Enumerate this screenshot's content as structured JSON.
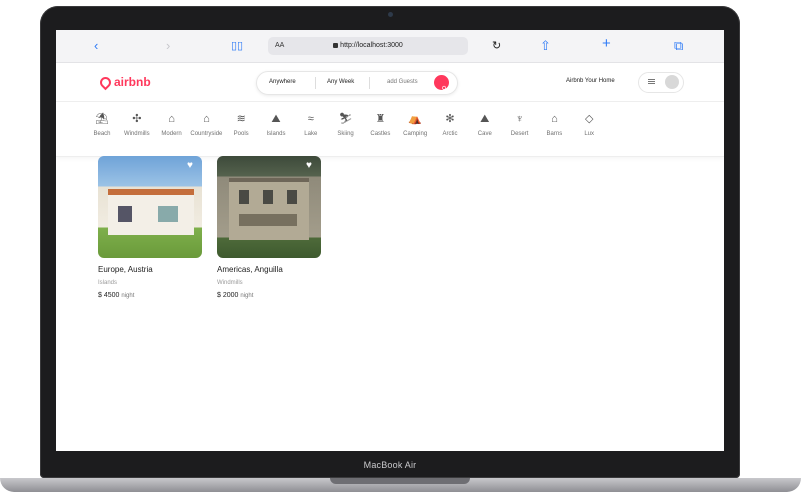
{
  "device": {
    "label": "MacBook Air"
  },
  "browser": {
    "back": "‹",
    "forward": "›",
    "text_size": "AA",
    "url": "http://localhost:3000",
    "reload": "↻",
    "share": "⇧",
    "new_tab": "+",
    "tabs": "⧉"
  },
  "header": {
    "logo": "airbnb",
    "search": {
      "anywhere": "Anywhere",
      "any_week": "Any Week",
      "add_guests": "add Guests"
    },
    "host_link": "Airbnb Your Home"
  },
  "categories": [
    {
      "label": "Beach",
      "icon": "beach-icon",
      "glyph": "⛱"
    },
    {
      "label": "Windmills",
      "icon": "windmill-icon",
      "glyph": "✣"
    },
    {
      "label": "Modern",
      "icon": "modern-icon",
      "glyph": "⌂"
    },
    {
      "label": "Countryside",
      "icon": "countryside-icon",
      "glyph": "⌂"
    },
    {
      "label": "Pools",
      "icon": "pool-icon",
      "glyph": "≋"
    },
    {
      "label": "Islands",
      "icon": "island-icon",
      "glyph": "⛰"
    },
    {
      "label": "Lake",
      "icon": "lake-icon",
      "glyph": "≈"
    },
    {
      "label": "Skiing",
      "icon": "skiing-icon",
      "glyph": "⛷"
    },
    {
      "label": "Castles",
      "icon": "castle-icon",
      "glyph": "♜"
    },
    {
      "label": "Camping",
      "icon": "camping-icon",
      "glyph": "⛺"
    },
    {
      "label": "Arctic",
      "icon": "snowflake-icon",
      "glyph": "✻"
    },
    {
      "label": "Cave",
      "icon": "cave-icon",
      "glyph": "⛰"
    },
    {
      "label": "Desert",
      "icon": "cactus-icon",
      "glyph": "♆"
    },
    {
      "label": "Barns",
      "icon": "barn-icon",
      "glyph": "⌂"
    },
    {
      "label": "Lux",
      "icon": "diamond-icon",
      "glyph": "◇"
    }
  ],
  "listings": [
    {
      "title": "Europe, Austria",
      "category": "Islands",
      "price": "$ 4500",
      "per": "night"
    },
    {
      "title": "Americas, Anguilla",
      "category": "Windmills",
      "price": "$ 2000",
      "per": "night"
    }
  ],
  "colors": {
    "accent": "#ff385c",
    "safari_blue": "#2f7bf6"
  }
}
